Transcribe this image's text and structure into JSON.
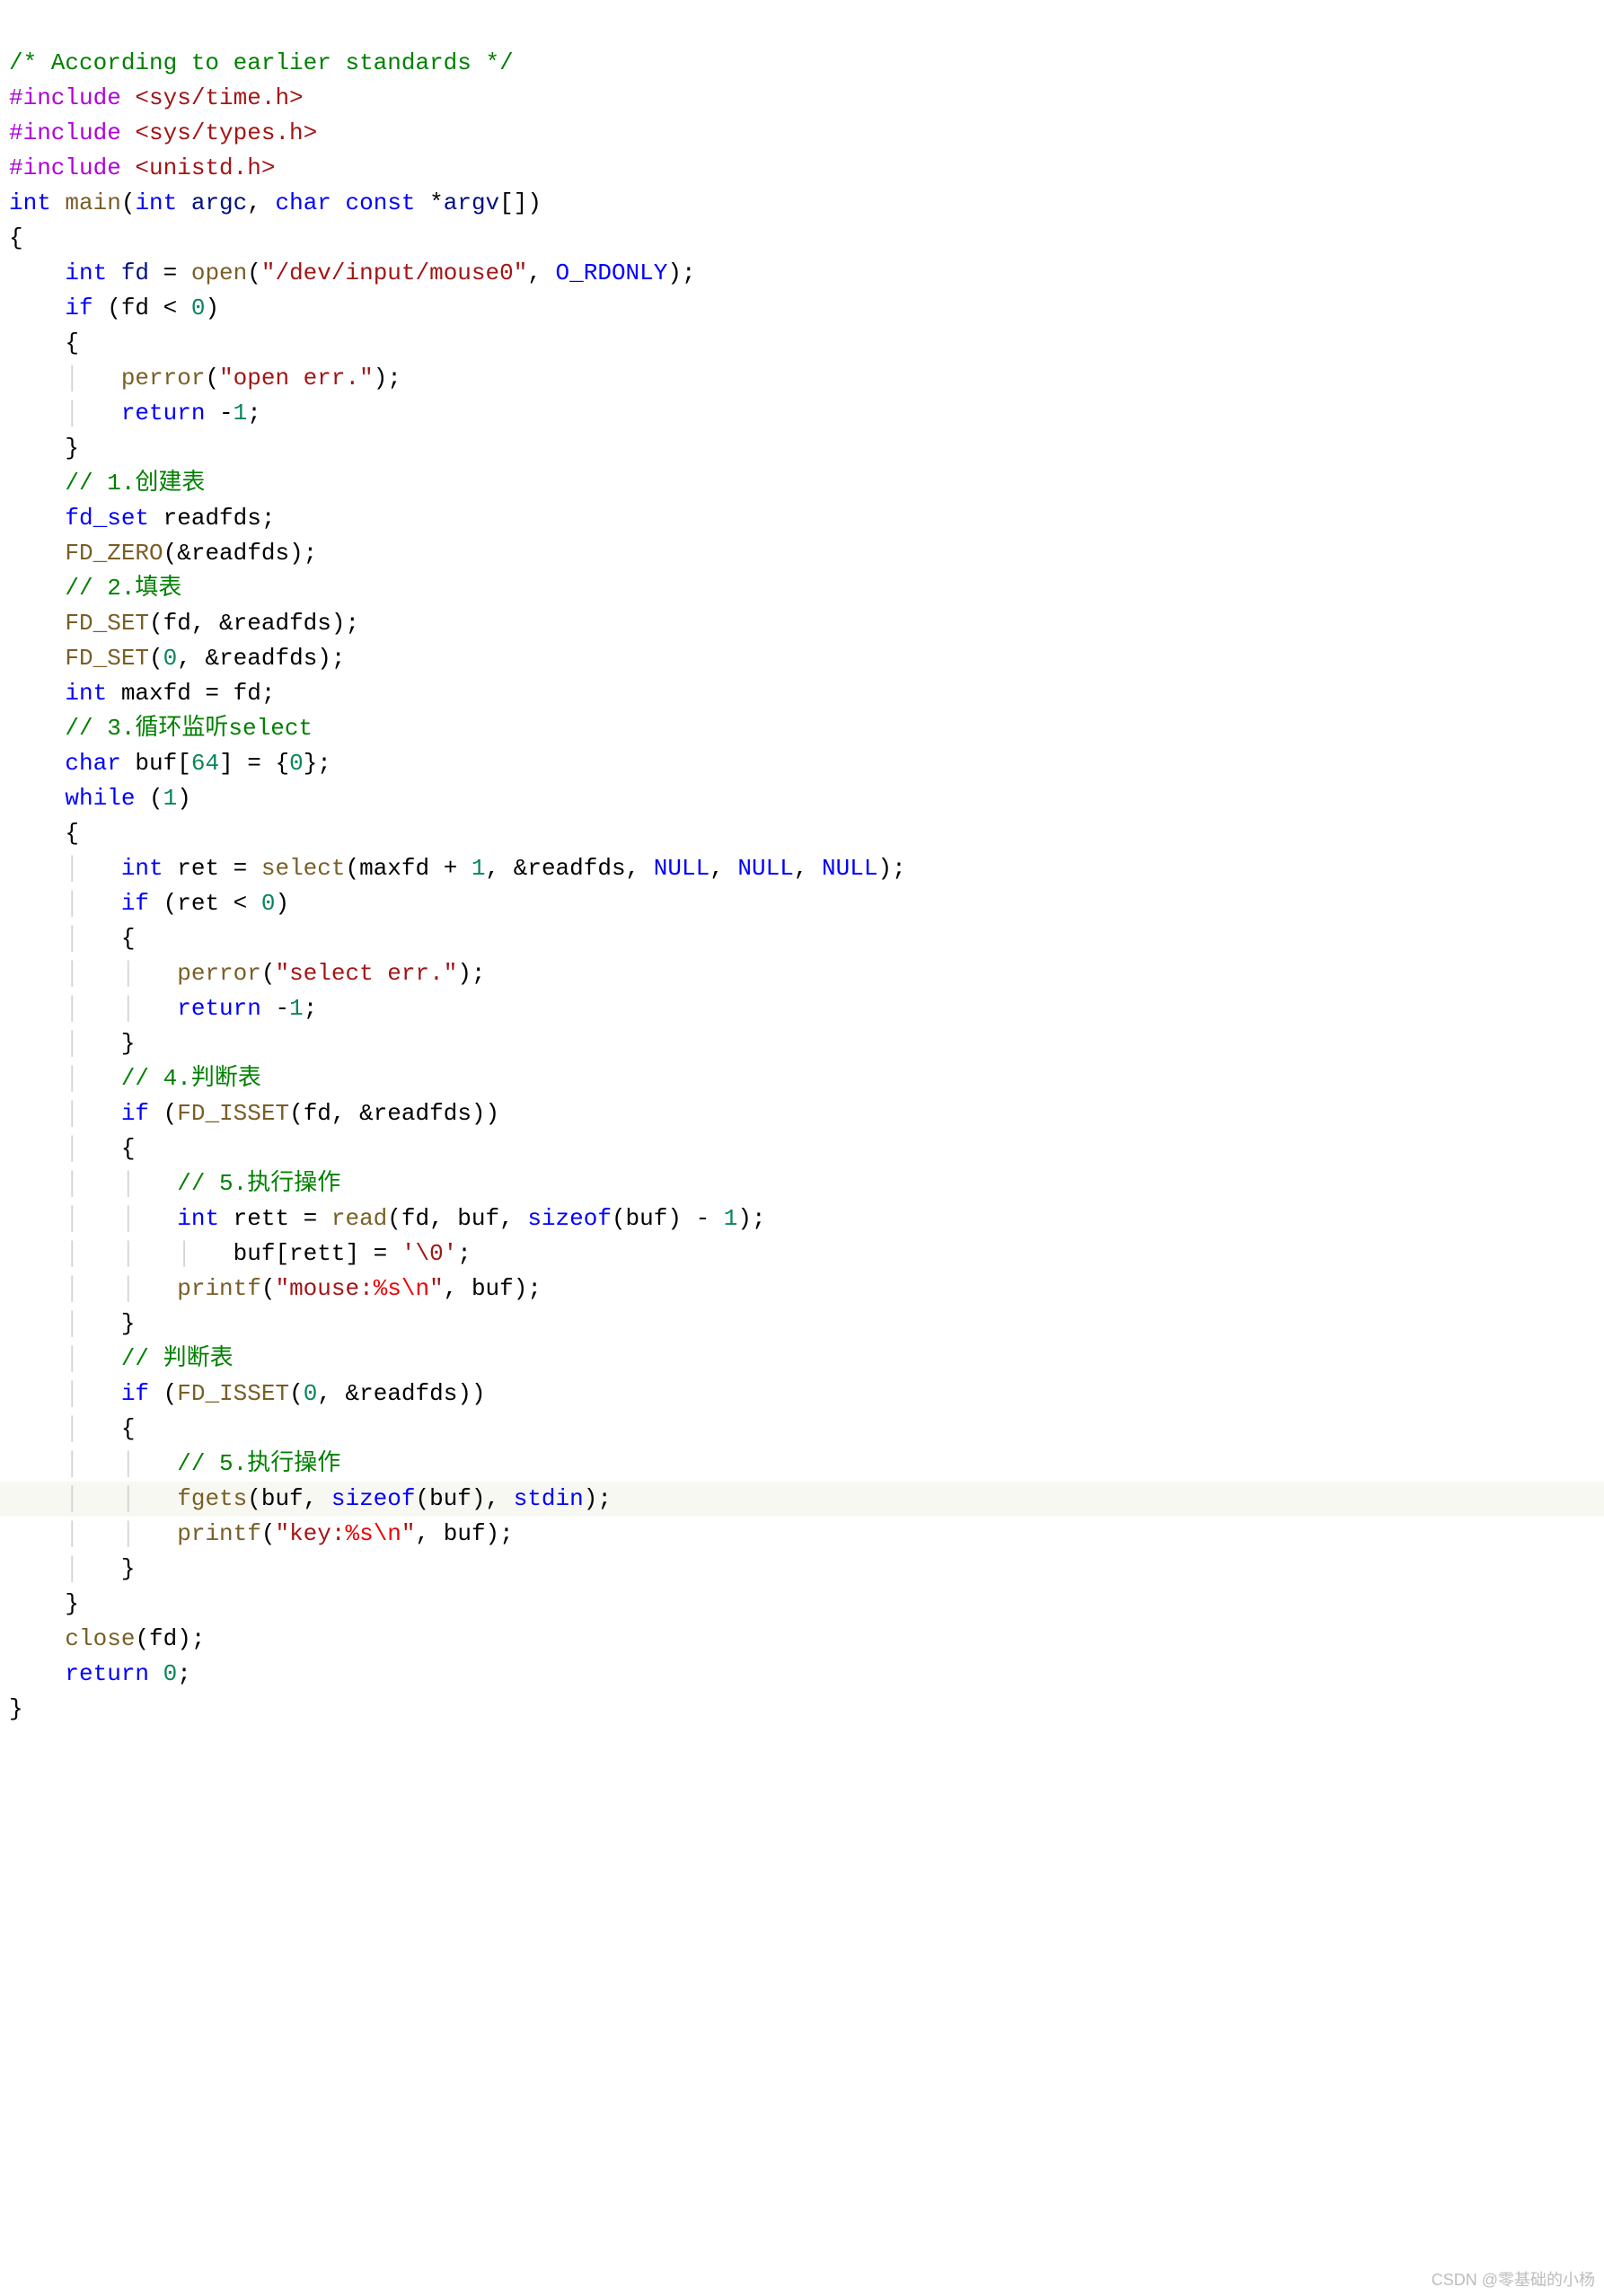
{
  "watermark": "CSDN @零基础的小杨",
  "lines": {
    "l1": "/* According to earlier standards */",
    "l2a": "#include",
    "l2b": " <sys/time.h>",
    "l3a": "#include",
    "l3b": " <sys/types.h>",
    "l4a": "#include",
    "l4b": " <unistd.h>",
    "l5_int": "int",
    "l5_main": " main",
    "l5_p1": "(",
    "l5_int2": "int",
    "l5_argc": " argc",
    "l5_comma": ", ",
    "l5_char": "char",
    "l5_const": " const",
    "l5_star": " *",
    "l5_argv": "argv",
    "l5_p2": "[])",
    "l6": "{",
    "l7_int": "    int",
    "l7_fd": " fd",
    "l7_eq": " = ",
    "l7_open": "open",
    "l7_p1": "(",
    "l7_str": "\"/dev/input/mouse0\"",
    "l7_c": ", ",
    "l7_flag": "O_RDONLY",
    "l7_p2": ");",
    "l8_if": "    if",
    "l8_rest": " (fd < ",
    "l8_num": "0",
    "l8_p": ")",
    "l9": "    {",
    "l10_g": "    │   ",
    "l10_fn": "perror",
    "l10_p1": "(",
    "l10_str": "\"open err.\"",
    "l10_p2": ");",
    "l11_g": "    │   ",
    "l11_ret": "return",
    "l11_sp": " -",
    "l11_num": "1",
    "l11_semi": ";",
    "l12": "    }",
    "l13_cm": "    // 1.创建表",
    "l14_pre": "    ",
    "l14_type": "fd_set",
    "l14_var": " readfds;",
    "l15_pre": "    ",
    "l15_fn": "FD_ZERO",
    "l15_rest": "(&readfds);",
    "l16_cm": "    // 2.填表",
    "l17_pre": "    ",
    "l17_fn": "FD_SET",
    "l17_rest": "(fd, &readfds);",
    "l18_pre": "    ",
    "l18_fn": "FD_SET",
    "l18_p1": "(",
    "l18_num": "0",
    "l18_rest": ", &readfds);",
    "l19_int": "    int",
    "l19_rest": " maxfd = fd;",
    "l20_cm": "    // 3.循环监听select",
    "l21_char": "    char",
    "l21_buf": " buf[",
    "l21_n64": "64",
    "l21_mid": "] = {",
    "l21_n0": "0",
    "l21_end": "};",
    "l22_while": "    while",
    "l22_p1": " (",
    "l22_num": "1",
    "l22_p2": ")",
    "l23": "    {",
    "l24_g": "    │   ",
    "l24_int": "int",
    "l24_ret": " ret = ",
    "l24_fn": "select",
    "l24_p1": "(maxfd + ",
    "l24_n1": "1",
    "l24_mid": ", &readfds, ",
    "l24_null1": "NULL",
    "l24_c1": ", ",
    "l24_null2": "NULL",
    "l24_c2": ", ",
    "l24_null3": "NULL",
    "l24_p2": ");",
    "l25_g": "    │   ",
    "l25_if": "if",
    "l25_rest": " (ret < ",
    "l25_num": "0",
    "l25_p": ")",
    "l26_g": "    │   ",
    "l26": "{",
    "l27_g": "    │   │   ",
    "l27_fn": "perror",
    "l27_p1": "(",
    "l27_str": "\"select err.\"",
    "l27_p2": ");",
    "l28_g": "    │   │   ",
    "l28_ret": "return",
    "l28_sp": " -",
    "l28_num": "1",
    "l28_semi": ";",
    "l29_g": "    │   ",
    "l29": "}",
    "l30_g": "    │   ",
    "l30_cm": "// 4.判断表",
    "l31_g": "    │   ",
    "l31_if": "if",
    "l31_p1": " (",
    "l31_fn": "FD_ISSET",
    "l31_rest": "(fd, &readfds))",
    "l32_g": "    │   ",
    "l32": "{",
    "l33_g": "    │   │   ",
    "l33_cm": "// 5.执行操作",
    "l34_g": "    │   │   ",
    "l34_int": "int",
    "l34_rett": " rett = ",
    "l34_fn": "read",
    "l34_p1": "(fd, buf, ",
    "l34_sz": "sizeof",
    "l34_mid": "(buf) - ",
    "l34_n1": "1",
    "l34_p2": ");",
    "l35_g": "    │   │   │   ",
    "l35_rest": "buf[rett] = ",
    "l35_str": "'\\0'",
    "l35_semi": ";",
    "l36_g": "    │   │   ",
    "l36_fn": "printf",
    "l36_p1": "(",
    "l36_s1": "\"mouse:",
    "l36_e1": "%s",
    "l36_e2": "\\n",
    "l36_s2": "\"",
    "l36_rest": ", buf);",
    "l37_g": "    │   ",
    "l37": "}",
    "l38_g": "    │   ",
    "l38_cm": "// 判断表",
    "l39_g": "    │   ",
    "l39_if": "if",
    "l39_p1": " (",
    "l39_fn": "FD_ISSET",
    "l39_p2": "(",
    "l39_num": "0",
    "l39_rest": ", &readfds))",
    "l40_g": "    │   ",
    "l40": "{",
    "l41_g": "    │   │   ",
    "l41_cm": "// 5.执行操作",
    "l42_g": "    │   │   ",
    "l42_fn": "fgets",
    "l42_p1": "(buf, ",
    "l42_sz": "sizeof",
    "l42_mid": "(buf), ",
    "l42_stdin": "stdin",
    "l42_p2": ");",
    "l43_g": "    │   │   ",
    "l43_fn": "printf",
    "l43_p1": "(",
    "l43_s1": "\"key:",
    "l43_e1": "%s",
    "l43_e2": "\\n",
    "l43_s2": "\"",
    "l43_rest": ", buf);",
    "l44_g": "    │   ",
    "l44": "}",
    "l45": "    }",
    "l46_pre": "    ",
    "l46_fn": "close",
    "l46_rest": "(fd);",
    "l47_ret": "    return",
    "l47_sp": " ",
    "l47_num": "0",
    "l47_semi": ";",
    "l48": "}"
  }
}
